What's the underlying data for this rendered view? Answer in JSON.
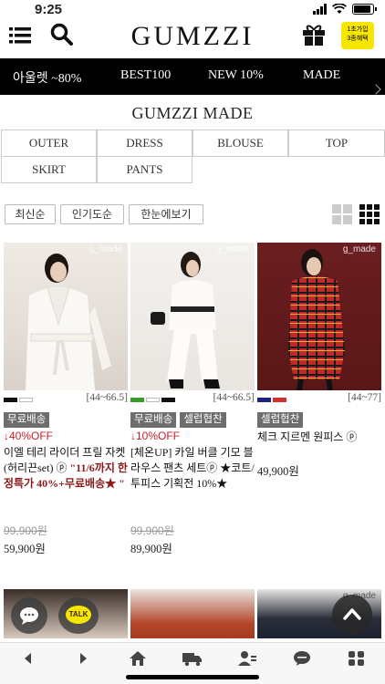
{
  "status_bar": {
    "time": "9:25"
  },
  "header": {
    "logo": "GUMZZI",
    "promo_line1": "1초가입",
    "promo_line2": "3종혜택"
  },
  "nav": [
    "아울렛 ~80%",
    "BEST100",
    "NEW 10%",
    "MADE"
  ],
  "section_title": "GUMZZI MADE",
  "categories": [
    "OUTER",
    "DRESS",
    "BLOUSE",
    "TOP",
    "SKIRT",
    "PANTS"
  ],
  "sort_options": [
    "최신순",
    "인기도순",
    "한눈에보기"
  ],
  "watermark": "g_made",
  "products": [
    {
      "swatch_colors": [
        "#111111",
        "#ffffff"
      ],
      "sizes": "[44~66.5]",
      "badges": [
        "무료배송"
      ],
      "discount": "↓40%OFF",
      "name": "이엘 테리 라이더 프릴 자켓 (허리끈set) ⓟ",
      "promo": "\"11/6까지 한정특가 40%+무료배송★ \"",
      "orig_price": "99,900원",
      "price": "59,900원"
    },
    {
      "swatch_colors": [
        "#3a9a2a",
        "#ffffff",
        "#111111"
      ],
      "sizes": "[44~66.5]",
      "badges": [
        "무료배송",
        "셀럽협찬"
      ],
      "discount": "↓10%OFF",
      "name": "[체온UP] 카일 버클 기모 블라우스 팬츠 세트ⓟ ★코트/투피스 기획전 10%★",
      "promo": "",
      "orig_price": "99,900원",
      "price": "89,900원"
    },
    {
      "swatch_colors": [
        "#1a237e",
        "#d32f2f"
      ],
      "sizes": "[44~77]",
      "badges": [
        "셀럽협찬"
      ],
      "discount": "",
      "name": "체크 지르멘 원피스 ⓟ",
      "promo": "",
      "orig_price": "",
      "price": "49,900원"
    }
  ],
  "floating": {
    "talk_label": "TALK"
  }
}
